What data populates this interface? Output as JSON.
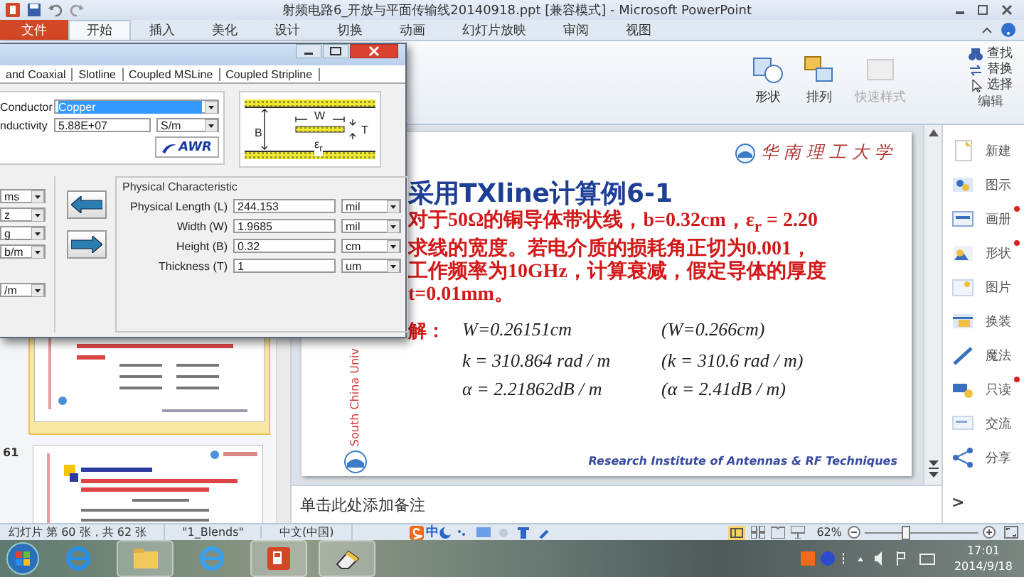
{
  "window": {
    "title": "射频电路6_开放与平面传输线20140918.ppt [兼容模式] - Microsoft PowerPoint"
  },
  "ribbon": {
    "tabs": [
      {
        "label": "文件",
        "kind": "file",
        "selected": false
      },
      {
        "label": "开始",
        "kind": "tab",
        "selected": true
      },
      {
        "label": "插入",
        "kind": "tab",
        "selected": false
      },
      {
        "label": "美化",
        "kind": "tab",
        "selected": false
      },
      {
        "label": "设计",
        "kind": "tab",
        "selected": false
      },
      {
        "label": "切换",
        "kind": "tab",
        "selected": false
      },
      {
        "label": "动画",
        "kind": "tab",
        "selected": false
      },
      {
        "label": "幻灯片放映",
        "kind": "tab",
        "selected": false
      },
      {
        "label": "审阅",
        "kind": "tab",
        "selected": false
      },
      {
        "label": "视图",
        "kind": "tab",
        "selected": false
      }
    ],
    "buttons": [
      {
        "label": "形状",
        "disabled": false
      },
      {
        "label": "排列",
        "disabled": false
      },
      {
        "label": "快速样式",
        "disabled": true
      }
    ],
    "editing": {
      "items": [
        "查找",
        "替换",
        "选择"
      ],
      "group_label": "编辑"
    }
  },
  "dialog": {
    "tabs": [
      {
        "label": "and Coaxial",
        "selected": false
      },
      {
        "label": "Slotline",
        "selected": false
      },
      {
        "label": "Coupled MSLine",
        "selected": false
      },
      {
        "label": "Coupled Stripline",
        "selected": false
      }
    ],
    "material": {
      "conductor_label": "Conductor",
      "conductor": "Copper",
      "conductivity_label": "nductivity",
      "conductivity": "5.88E+07",
      "conductivity_unit": "S/m",
      "logo": "AWR"
    },
    "diagram_labels": {
      "width": "W",
      "height": "B",
      "thickness": "T",
      "permittivity": "ε$_{r}$"
    },
    "left_units": [
      "ms",
      "z",
      "g",
      "b/m",
      "/m"
    ],
    "physical": {
      "title": "Physical Characteristic",
      "rows": [
        {
          "label": "Physical Length (L)",
          "value": "244.153",
          "unit": "mil"
        },
        {
          "label": "Width (W)",
          "value": "1.9685",
          "unit": "mil"
        },
        {
          "label": "Height (B)",
          "value": "0.32",
          "unit": "cm"
        },
        {
          "label": "Thickness (T)",
          "value": "1",
          "unit": "um"
        }
      ]
    }
  },
  "thumbnails": [
    {
      "selected": true
    },
    {
      "number": "61",
      "selected": false
    }
  ],
  "slide": {
    "side_text": "South China Univ",
    "university": "华南理工大学",
    "title": "采用TXline计算例6-1",
    "lines": [
      "对于50Ω的铜导体带状线，b=0.32cm，ε$_{r}$ = 2.20",
      "求线的宽度。若电介质的损耗角正切为0.001，",
      "工作频率为10GHz，计算衰减，假定导体的厚度",
      "t=0.01mm。"
    ],
    "solution_label": "解：",
    "results": [
      {
        "computed": "W=0.26151cm",
        "reference": "(W=0.266cm)"
      },
      {
        "computed": "k = 310.864  rad / m",
        "reference": "(k = 310.6 rad / m)"
      },
      {
        "computed": "α = 2.21862dB / m",
        "reference": "(α = 2.41dB / m)"
      }
    ],
    "footer": "Research Institute of  Antennas & RF Techniques"
  },
  "notes": {
    "text": "单击此处添加备注"
  },
  "sidebar": {
    "items": [
      {
        "label": "新建",
        "badge": false
      },
      {
        "label": "图示",
        "badge": false
      },
      {
        "label": "画册",
        "badge": true
      },
      {
        "label": "形状",
        "badge": true
      },
      {
        "label": "图片",
        "badge": false
      },
      {
        "label": "换装",
        "badge": false
      },
      {
        "label": "魔法",
        "badge": false
      },
      {
        "label": "只读",
        "badge": true
      },
      {
        "label": "交流",
        "badge": false
      },
      {
        "label": "分享",
        "badge": false
      }
    ],
    "expand": ">"
  },
  "status_bar": {
    "slide_info": "幻灯片 第 60 张，共 62 张",
    "theme": "\"1_Blends\"",
    "language": "中文(中国)",
    "ime": "中",
    "zoom": "62%",
    "zoom_slider": {
      "level": 0.33
    }
  },
  "taskbar": {
    "time": "17:01",
    "date": "2014/9/18"
  }
}
